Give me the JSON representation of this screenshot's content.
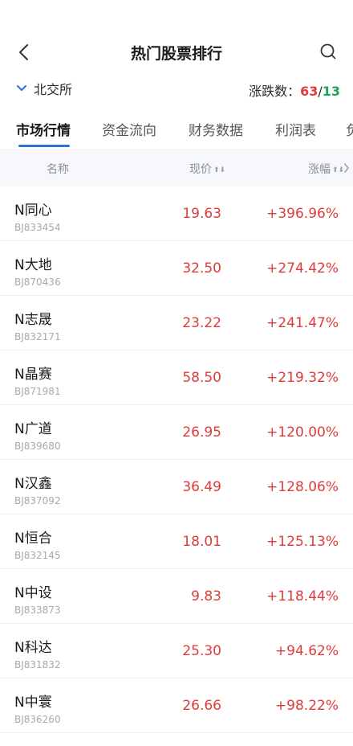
{
  "header": {
    "title": "热门股票排行"
  },
  "market": {
    "name": "北交所",
    "adv_label": "涨跌数：",
    "up": "63",
    "sep": "/",
    "down": "13"
  },
  "tabs": [
    {
      "label": "市场行情"
    },
    {
      "label": "资金流向"
    },
    {
      "label": "财务数据"
    },
    {
      "label": "利润表"
    },
    {
      "label": "负"
    }
  ],
  "columns": {
    "name": "名称",
    "price": "现价",
    "change": "涨幅",
    "sort": "⬆⬇"
  },
  "colors": {
    "up": "#e03b3b",
    "down": "#1aa35a",
    "accent": "#2f6fd6"
  },
  "stocks": [
    {
      "name": "N同心",
      "code": "BJ833454",
      "price": "19.63",
      "change": "+396.96%"
    },
    {
      "name": "N大地",
      "code": "BJ870436",
      "price": "32.50",
      "change": "+274.42%"
    },
    {
      "name": "N志晟",
      "code": "BJ832171",
      "price": "23.22",
      "change": "+241.47%"
    },
    {
      "name": "N晶赛",
      "code": "BJ871981",
      "price": "58.50",
      "change": "+219.32%"
    },
    {
      "name": "N广道",
      "code": "BJ839680",
      "price": "26.95",
      "change": "+120.00%"
    },
    {
      "name": "N汉鑫",
      "code": "BJ837092",
      "price": "36.49",
      "change": "+128.06%"
    },
    {
      "name": "N恒合",
      "code": "BJ832145",
      "price": "18.01",
      "change": "+125.13%"
    },
    {
      "name": "N中设",
      "code": "BJ833873",
      "price": "9.83",
      "change": "+118.44%"
    },
    {
      "name": "N科达",
      "code": "BJ831832",
      "price": "25.30",
      "change": "+94.62%"
    },
    {
      "name": "N中寰",
      "code": "BJ836260",
      "price": "26.66",
      "change": "+98.22%"
    }
  ]
}
